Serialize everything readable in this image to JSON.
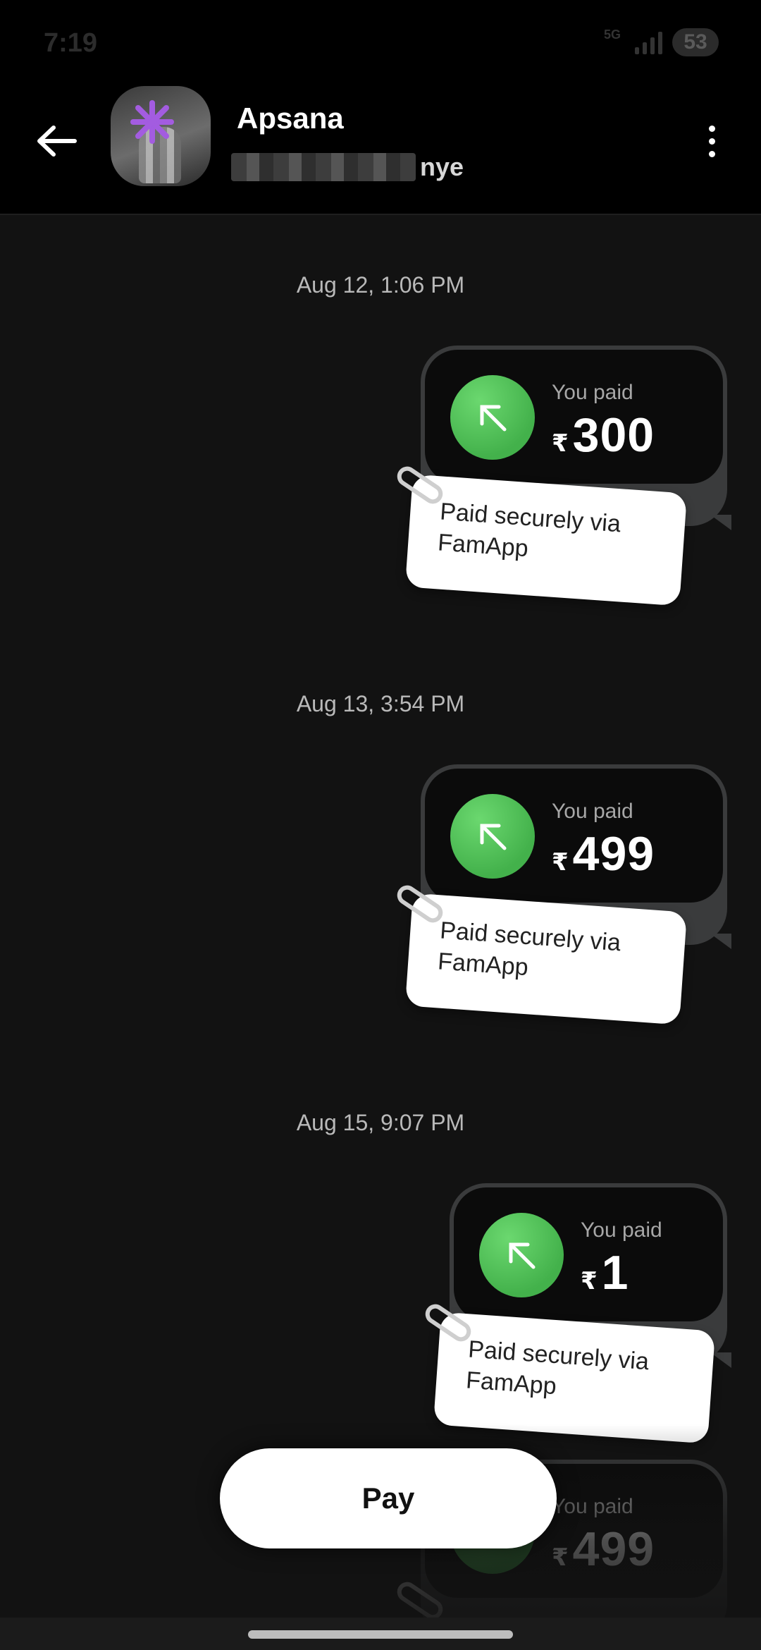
{
  "status_bar": {
    "time": "7:19",
    "network": "5G",
    "battery": "53"
  },
  "header": {
    "contact_name": "Apsana",
    "contact_sub_visible": "nye"
  },
  "messages": [
    {
      "timestamp": "Aug 12, 1:06 PM",
      "label": "You paid",
      "currency": "₹",
      "amount": "300",
      "note": "Paid securely via FamApp"
    },
    {
      "timestamp": "Aug 13, 3:54 PM",
      "label": "You paid",
      "currency": "₹",
      "amount": "499",
      "note": "Paid securely via FamApp"
    },
    {
      "timestamp": "Aug 15, 9:07 PM",
      "label": "You paid",
      "currency": "₹",
      "amount": "1",
      "note": "Paid securely via FamApp"
    },
    {
      "label": "You paid",
      "currency": "₹",
      "amount": "499"
    }
  ],
  "pay_button": {
    "label": "Pay"
  },
  "colors": {
    "background": "#121212",
    "header": "#000000",
    "accent_green": "#4cbb50",
    "bubble_border": "#3a3b3c"
  },
  "icons": {
    "back": "arrow-left-icon",
    "menu": "more-vertical-icon",
    "payment": "arrow-up-left-icon",
    "note": "paperclip-icon"
  }
}
